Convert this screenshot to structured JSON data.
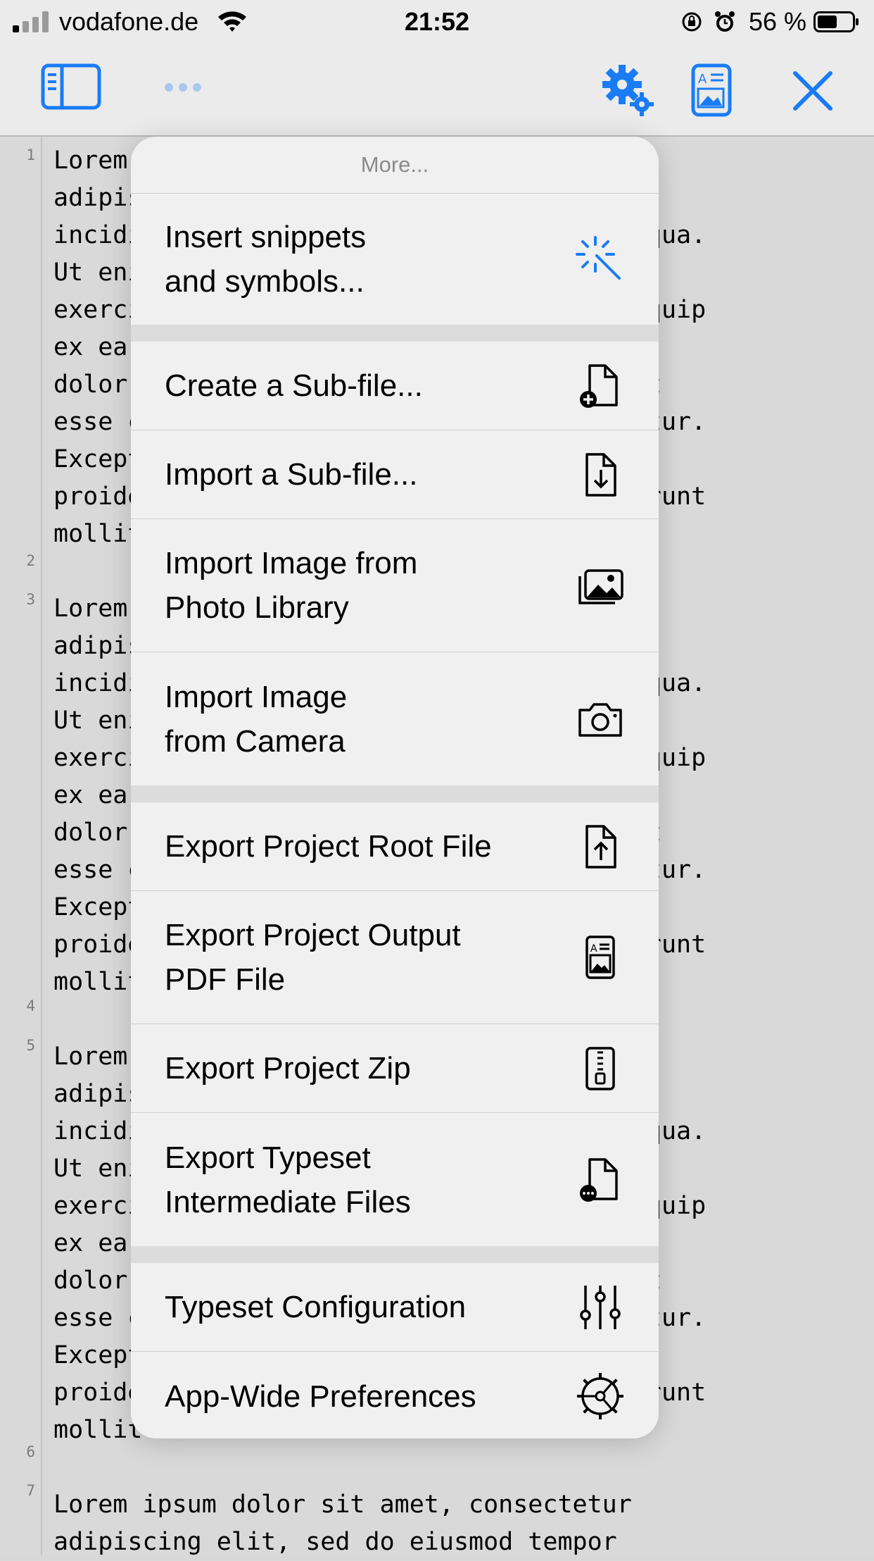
{
  "status_bar": {
    "carrier": "vodafone.de",
    "time": "21:52",
    "battery_percent": "56 %",
    "icons": [
      "signal-icon",
      "wifi-icon",
      "orientation-lock-icon",
      "alarm-icon",
      "battery-icon"
    ]
  },
  "toolbar": {
    "accent_color": "#1a7cf5",
    "buttons": [
      "sidebar-toggle-icon",
      "more-dots-icon",
      "settings-gears-icon",
      "pdf-preview-icon",
      "close-icon"
    ]
  },
  "editor": {
    "line_numbers": [
      "1",
      "2",
      "3",
      "4",
      "5",
      "6",
      "7"
    ],
    "paragraph_lines": [
      "Lorem ipsum dolor sit amet, consectetur",
      "adipiscing elit, sed do eiusmod tempor",
      "incididunt ut labore et dolore magna aliqua.",
      "Ut enim ad minim veniam, quis nostrud",
      "exercitation ullamco laboris nisi ut aliquip",
      "ex ea commodo consequat. Duis aute irure",
      "dolor in reprehenderit in voluptate velit",
      "esse cillum dolore eu fugiat nulla pariatur.",
      "Excepteur sint occaecat cupidatat non",
      "proident, sunt in culpa qui officia deserunt",
      "mollit anim id est laborum."
    ],
    "last_paragraph_lines": [
      "Lorem ipsum dolor sit amet, consectetur",
      "adipiscing elit, sed do eiusmod tempor"
    ]
  },
  "menu": {
    "title": "More...",
    "sections": [
      [
        {
          "line1": "Insert snippets",
          "line2": "and symbols...",
          "icon": "magic-wand-icon",
          "accent": true
        }
      ],
      [
        {
          "line1": "Create a Sub-file...",
          "line2": "",
          "icon": "doc-plus-icon"
        },
        {
          "line1": "Import a Sub-file...",
          "line2": "",
          "icon": "doc-download-icon"
        },
        {
          "line1": "Import Image from",
          "line2": "Photo Library",
          "icon": "photo-library-icon"
        },
        {
          "line1": "Import Image",
          "line2": "from Camera",
          "icon": "camera-icon"
        }
      ],
      [
        {
          "line1": "Export Project Root File",
          "line2": "",
          "icon": "doc-upload-icon"
        },
        {
          "line1": "Export Project Output",
          "line2": "PDF File",
          "icon": "pdf-doc-icon"
        },
        {
          "line1": "Export Project Zip",
          "line2": "",
          "icon": "zip-doc-icon"
        },
        {
          "line1": "Export Typeset",
          "line2": "Intermediate Files",
          "icon": "doc-ellipsis-icon"
        }
      ],
      [
        {
          "line1": "Typeset Configuration",
          "line2": "",
          "icon": "sliders-icon"
        },
        {
          "line1": "App-Wide Preferences",
          "line2": "",
          "icon": "gear-icon"
        }
      ]
    ]
  }
}
